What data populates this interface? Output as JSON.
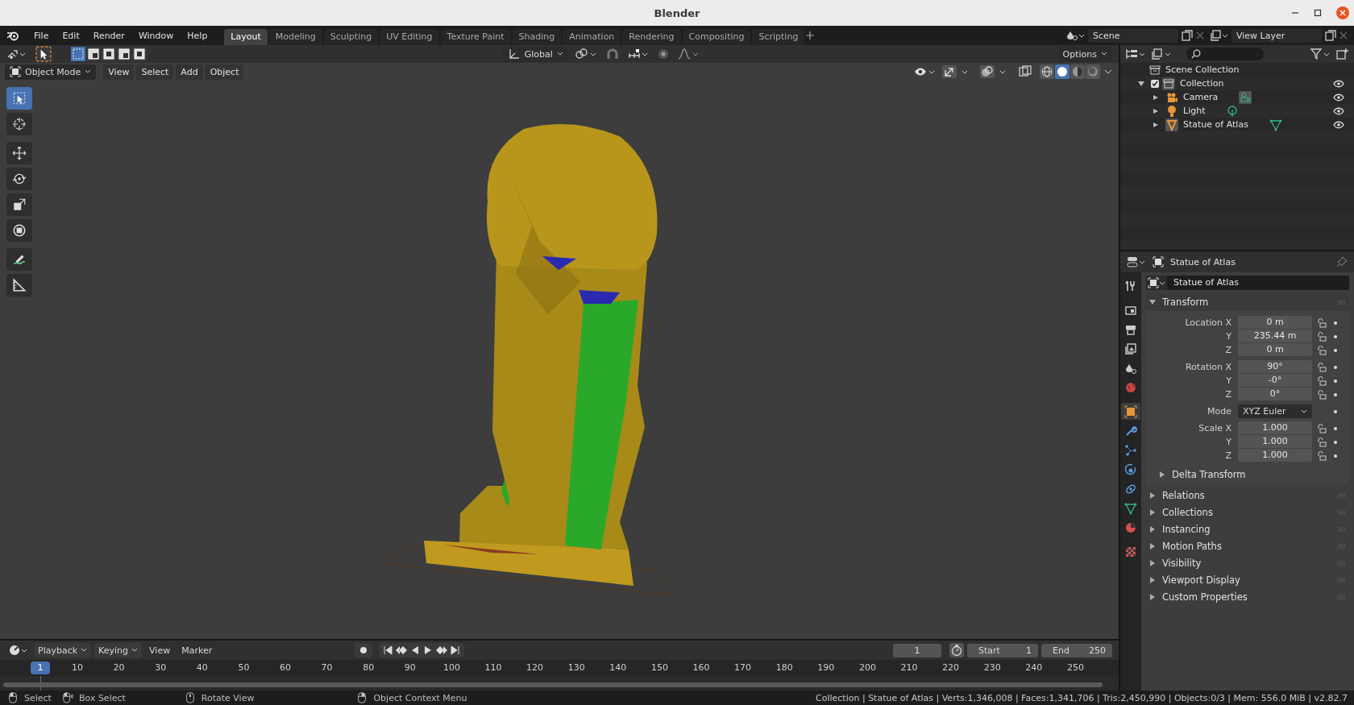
{
  "window": {
    "title": "Blender"
  },
  "menu": [
    "File",
    "Edit",
    "Render",
    "Window",
    "Help"
  ],
  "workspaces": [
    {
      "label": "Layout",
      "selected": true
    },
    {
      "label": "Modeling",
      "selected": false
    },
    {
      "label": "Sculpting",
      "selected": false
    },
    {
      "label": "UV Editing",
      "selected": false
    },
    {
      "label": "Texture Paint",
      "selected": false
    },
    {
      "label": "Shading",
      "selected": false
    },
    {
      "label": "Animation",
      "selected": false
    },
    {
      "label": "Rendering",
      "selected": false
    },
    {
      "label": "Compositing",
      "selected": false
    },
    {
      "label": "Scripting",
      "selected": false
    }
  ],
  "scene": {
    "scene": "Scene",
    "view_layer": "View Layer"
  },
  "viewport": {
    "orientation": "Global",
    "options": "Options",
    "mode": "Object Mode",
    "menus": [
      "View",
      "Select",
      "Add",
      "Object"
    ],
    "select_modes": [
      {
        "selected": true
      },
      {
        "selected": false
      },
      {
        "selected": false
      },
      {
        "selected": false
      },
      {
        "selected": false
      }
    ],
    "tools": [
      {
        "kind": "select",
        "selected": true
      },
      {
        "kind": "cursor",
        "selected": false
      },
      {
        "kind": "move",
        "selected": false
      },
      {
        "kind": "rotate",
        "selected": false
      },
      {
        "kind": "scale",
        "selected": false
      },
      {
        "kind": "transform",
        "selected": false
      },
      {
        "kind": "annotate",
        "selected": false
      },
      {
        "kind": "measure",
        "selected": false
      }
    ],
    "shading": [
      {
        "kind": "wireframe",
        "selected": false
      },
      {
        "kind": "solid",
        "selected": true
      },
      {
        "kind": "material",
        "selected": false
      },
      {
        "kind": "rendered",
        "selected": false
      }
    ]
  },
  "outliner": {
    "root": "Scene Collection",
    "collection": {
      "label": "Collection",
      "checked": true,
      "expanded": true,
      "children": [
        {
          "label": "Camera",
          "kind": "camera"
        },
        {
          "label": "Light",
          "kind": "light"
        },
        {
          "label": "Statue of Atlas",
          "kind": "mesh"
        }
      ]
    }
  },
  "properties": {
    "header": "Statue of Atlas",
    "name": "Statue of Atlas",
    "tabs": [
      {
        "kind": "tool",
        "selected": false
      },
      {
        "kind": "render",
        "selected": false
      },
      {
        "kind": "output",
        "selected": false
      },
      {
        "kind": "view_layer",
        "selected": false
      },
      {
        "kind": "scene",
        "selected": false
      },
      {
        "kind": "world",
        "selected": false
      },
      {
        "kind": "object",
        "selected": true
      },
      {
        "kind": "modifier",
        "selected": false
      },
      {
        "kind": "particles",
        "selected": false
      },
      {
        "kind": "physics",
        "selected": false
      },
      {
        "kind": "constraints",
        "selected": false
      },
      {
        "kind": "data",
        "selected": false
      },
      {
        "kind": "material",
        "selected": false
      },
      {
        "kind": "texture",
        "selected": false
      }
    ],
    "transform": {
      "label": "Transform",
      "expanded": true,
      "groups": [
        {
          "rows": [
            {
              "label": "Location X",
              "value": "0 m",
              "kind": "number"
            },
            {
              "label": "Y",
              "value": "235.44 m",
              "kind": "number"
            },
            {
              "label": "Z",
              "value": "0 m",
              "kind": "number"
            }
          ]
        },
        {
          "rows": [
            {
              "label": "Rotation X",
              "value": "90°",
              "kind": "number"
            },
            {
              "label": "Y",
              "value": "-0°",
              "kind": "number"
            },
            {
              "label": "Z",
              "value": "0°",
              "kind": "number"
            }
          ]
        },
        {
          "rows": [
            {
              "label": "Mode",
              "value": "XYZ Euler",
              "kind": "dropdown"
            }
          ]
        },
        {
          "rows": [
            {
              "label": "Scale X",
              "value": "1.000",
              "kind": "number"
            },
            {
              "label": "Y",
              "value": "1.000",
              "kind": "number"
            },
            {
              "label": "Z",
              "value": "1.000",
              "kind": "number"
            }
          ]
        }
      ],
      "subpanel": {
        "label": "Delta Transform",
        "expanded": false
      }
    },
    "panels": [
      {
        "label": "Relations",
        "expanded": false
      },
      {
        "label": "Collections",
        "expanded": false
      },
      {
        "label": "Instancing",
        "expanded": false
      },
      {
        "label": "Motion Paths",
        "expanded": false
      },
      {
        "label": "Visibility",
        "expanded": false
      },
      {
        "label": "Viewport Display",
        "expanded": false
      },
      {
        "label": "Custom Properties",
        "expanded": false
      }
    ]
  },
  "timeline": {
    "menus": [
      {
        "label": "Playback",
        "kind": "dropdown"
      },
      {
        "label": "Keying",
        "kind": "dropdown"
      },
      {
        "label": "View",
        "kind": "plain"
      },
      {
        "label": "Marker",
        "kind": "plain"
      }
    ],
    "current_frame": "1",
    "start_label": "Start",
    "start": "1",
    "end_label": "End",
    "end": "250",
    "ruler_frame": "1",
    "ticks": [
      "10",
      "20",
      "30",
      "40",
      "50",
      "60",
      "70",
      "80",
      "90",
      "100",
      "110",
      "120",
      "130",
      "140",
      "150",
      "160",
      "170",
      "180",
      "190",
      "200",
      "210",
      "220",
      "230",
      "240",
      "250"
    ]
  },
  "status_bar": {
    "hints": [
      {
        "label": "Select",
        "kind": "left"
      },
      {
        "label": "Box Select",
        "kind": "drag"
      },
      {
        "label": "Rotate View",
        "kind": "middle"
      },
      {
        "label": "Object Context Menu",
        "kind": "right"
      }
    ],
    "stats": "Collection | Statue of Atlas | Verts:1,346,008 | Faces:1,341,706 | Tris:2,450,990 | Objects:0/3 | Mem: 556.0 MiB | v2.82.7"
  }
}
